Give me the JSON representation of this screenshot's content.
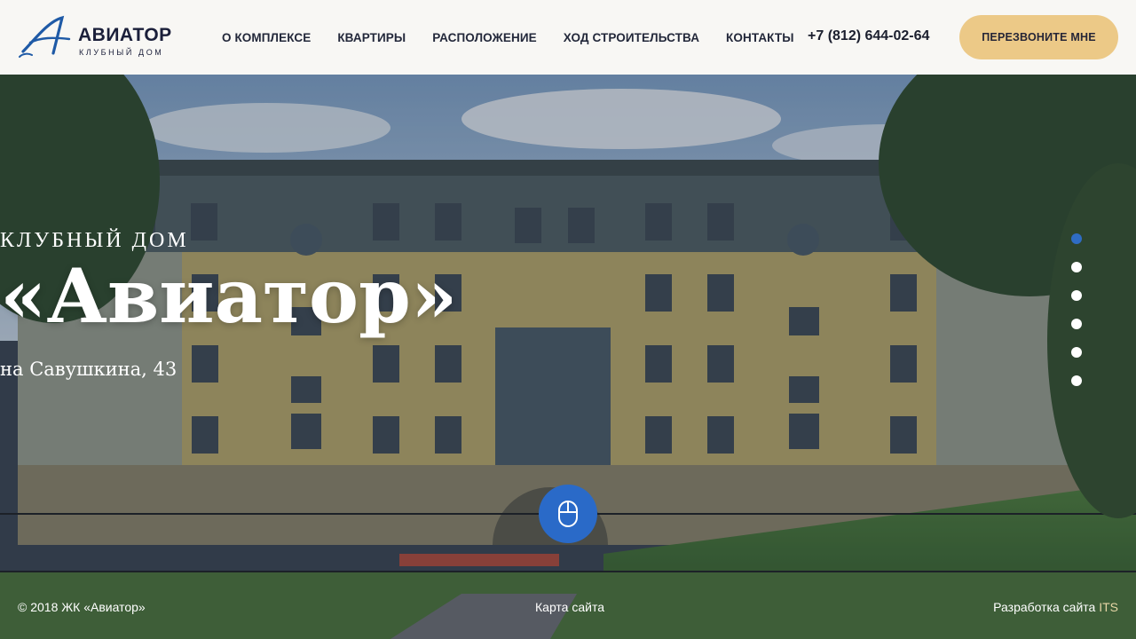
{
  "header": {
    "logo": {
      "title": "АВИАТОР",
      "subtitle": "КЛУБНЫЙ ДОМ"
    },
    "nav": [
      "О КОМПЛЕКСЕ",
      "КВАРТИРЫ",
      "РАСПОЛОЖЕНИЕ",
      "ХОД СТРОИТЕЛЬСТВА",
      "КОНТАКТЫ"
    ],
    "phone": "+7 (812) 644-02-64",
    "callback_label": "ПЕРЕЗВОНИТЕ МНЕ"
  },
  "hero": {
    "kicker": "КЛУБНЫЙ ДОМ",
    "title": "«Авиатор»",
    "subtitle": "на Савушкина, 43",
    "slides_count": 6,
    "active_slide": 1,
    "scroll_icon": "mouse-icon"
  },
  "footer": {
    "copyright": "© 2018 ЖК «Авиатор»",
    "sitemap": "Карта сайта",
    "dev_prefix": "Разработка сайта",
    "dev_name": "ITS"
  },
  "colors": {
    "accent": "#2a6ac8",
    "button": "#ecc987",
    "header_bg": "#f8f7f4",
    "text_dark": "#1b1f3a"
  }
}
